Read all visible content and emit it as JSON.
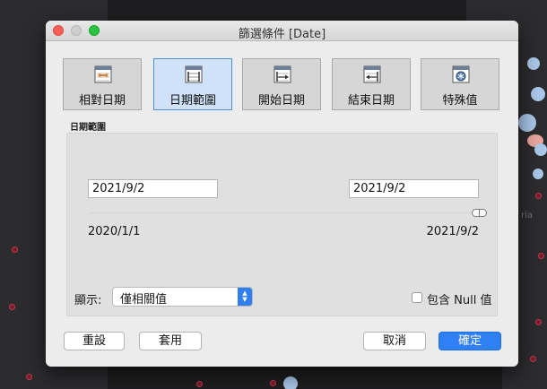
{
  "window": {
    "title": "篩選條件 [Date]"
  },
  "modes": [
    {
      "label": "相對日期",
      "icon": "calendar-relative-icon",
      "active": false
    },
    {
      "label": "日期範圍",
      "icon": "calendar-range-icon",
      "active": true
    },
    {
      "label": "開始日期",
      "icon": "calendar-start-icon",
      "active": false
    },
    {
      "label": "結束日期",
      "icon": "calendar-end-icon",
      "active": false
    },
    {
      "label": "特殊值",
      "icon": "calendar-special-icon",
      "active": false
    }
  ],
  "section_label": "日期範圍",
  "range": {
    "start_value": "2021/9/2",
    "end_value": "2021/9/2",
    "min_label": "2020/1/1",
    "max_label": "2021/9/2"
  },
  "show": {
    "label": "顯示:",
    "selected": "僅相關值"
  },
  "include_null": {
    "label": "包含 Null 值",
    "checked": false
  },
  "buttons": {
    "reset": "重設",
    "apply": "套用",
    "cancel": "取消",
    "ok": "確定"
  },
  "background": {
    "map_label": "ria"
  },
  "colors": {
    "accent": "#2f80f5",
    "active_tab_bg": "#cfe2f7",
    "active_tab_border": "#4f8fd4"
  }
}
